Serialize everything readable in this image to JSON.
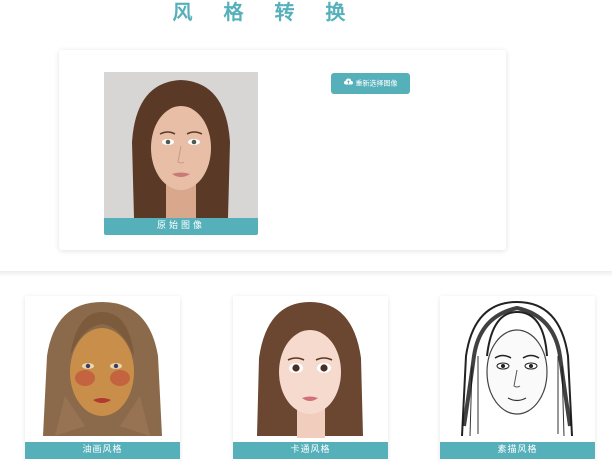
{
  "page": {
    "title": "风 格 转 换"
  },
  "upload": {
    "reselect_label": "重新选择图像",
    "reselect_icon": "cloud-upload-icon",
    "original_caption": "原始图像"
  },
  "results": [
    {
      "caption": "油画风格"
    },
    {
      "caption": "卡通风格"
    },
    {
      "caption": "素描风格"
    }
  ],
  "colors": {
    "accent": "#56b0ba"
  }
}
